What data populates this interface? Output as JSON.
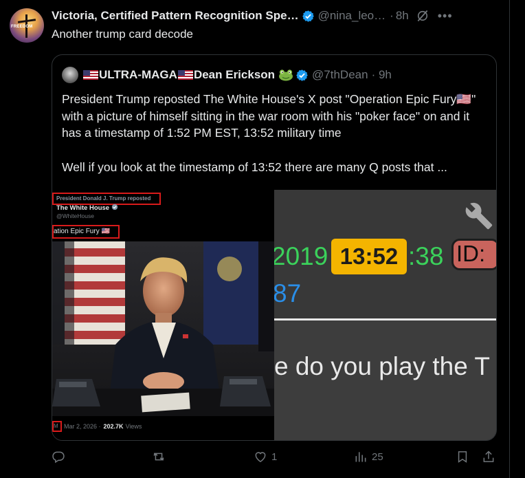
{
  "post": {
    "author_name": "Victoria, Certified Pattern Recognition Spe…",
    "author_handle": "@nina_leo…",
    "separator": "·",
    "time": "8h",
    "text": "Another trump card decode",
    "avatar_text": "FREEDOM"
  },
  "quote": {
    "author_name": "ULTRA-MAGA",
    "author_name_2": "Dean Erickson",
    "author_handle": "@7thDean",
    "time": "· 9h",
    "paragraph_1": "President Trump reposted The White House's X post \"Operation Epic Fury🇺🇸\" with a picture of himself sitting in the war room with his \"poker face\" on and it has a timestamp of 1:52 PM EST, 13:52 military time",
    "paragraph_2": "Well if you look at the timestamp of 13:52 there are many Q posts that ..."
  },
  "media_left": {
    "repost_label": "President Donald J. Trump reposted",
    "account_name": "The White House",
    "account_handle": "@WhiteHouse",
    "post_title": "ation Epic Fury 🇺🇸",
    "footer_m": "M",
    "footer_date": "Mar 2, 2026 ·",
    "footer_views": "202.7K",
    "footer_views_label": "Views"
  },
  "media_right": {
    "date_fragment": "2019",
    "time_box": "13:52",
    "seconds": ":38",
    "id_label": "ID:",
    "number_fragment": "87",
    "question_fragment": "e do you play the T"
  },
  "actions": {
    "reply_count": "",
    "repost_count": "",
    "like_count": "1",
    "views_count": "25"
  },
  "colors": {
    "background": "#000000",
    "verified": "#1d9bf0",
    "highlight_red": "#d91b1b",
    "q_green": "#3bd25b",
    "q_yellow": "#f4b400",
    "q_blue": "#2a8ee8"
  }
}
